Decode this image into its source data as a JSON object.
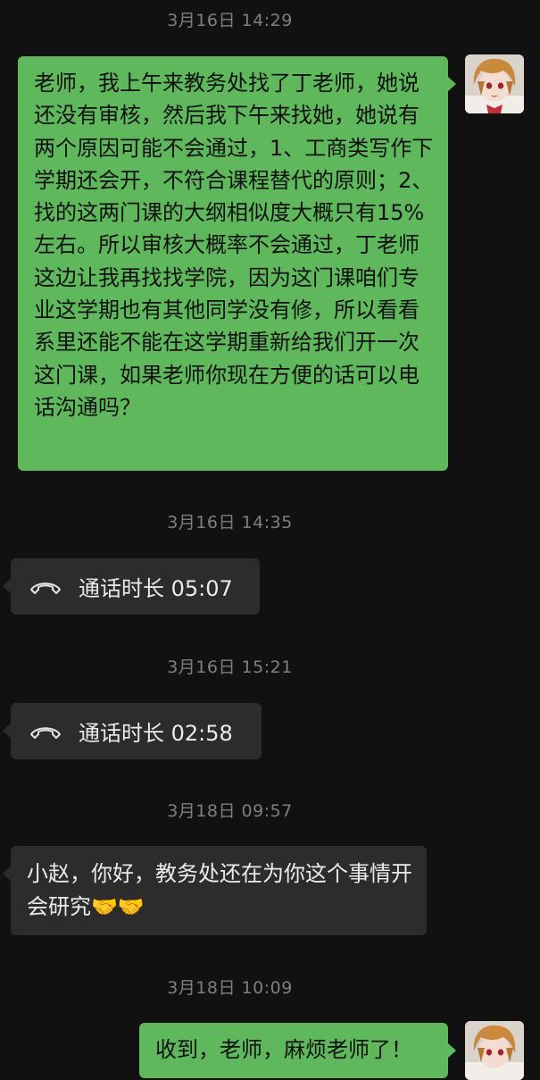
{
  "messages": [
    {
      "time": "3月16日 14:29"
    },
    {
      "text": "老师，我上午来教务处找了丁老师，她说还没有审核，然后我下午来找她，她说有两个原因可能不会通过，1、工商类写作下学期还会开，不符合课程替代的原则；2、找的这两门课的大纲相似度大概只有15%左右。所以审核大概率不会通过，丁老师这边让我再找找学院，因为这门课咱们专业这学期也有其他同学没有修，所以看看系里还能不能在这学期重新给我们开一次这门课，如果老师你现在方便的话可以电话沟通吗？"
    },
    {
      "time": "3月16日 14:35"
    },
    {
      "call": "通话时长 05:07"
    },
    {
      "time": "3月16日 15:21"
    },
    {
      "call": "通话时长 02:58"
    },
    {
      "time": "3月18日 09:57"
    },
    {
      "text": "小赵，你好，教务处还在为你这个事情开会研究🤝🤝"
    },
    {
      "time": "3月18日 10:09"
    },
    {
      "text": "收到，老师，麻烦老师了！"
    }
  ],
  "icons": {
    "call": "phone-hangup-icon",
    "avatar": "user-avatar"
  },
  "colors": {
    "background": "#111111",
    "outgoing_bubble": "#5fb85c",
    "incoming_bubble": "#2c2c2c",
    "timestamp": "#7f7f7f"
  }
}
